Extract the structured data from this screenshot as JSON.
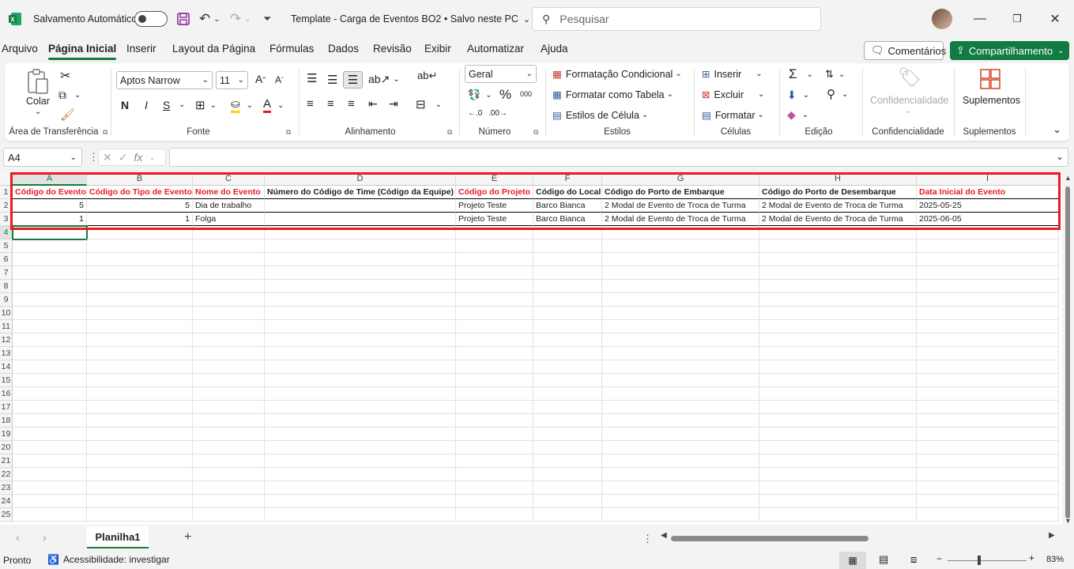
{
  "titlebar": {
    "autosave_label": "Salvamento Automático",
    "doc_title": "Template - Carga de Eventos BO2 • Salvo neste PC",
    "search_placeholder": "Pesquisar"
  },
  "menu": {
    "tabs": [
      "Arquivo",
      "Página Inicial",
      "Inserir",
      "Layout da Página",
      "Fórmulas",
      "Dados",
      "Revisão",
      "Exibir",
      "Automatizar",
      "Ajuda"
    ],
    "comments": "Comentários",
    "share": "Compartilhamento",
    "accent": "#107c41"
  },
  "ribbon": {
    "clipboard": {
      "paste": "Colar",
      "label": "Área de Transferência"
    },
    "font": {
      "name": "Aptos Narrow",
      "size": "11",
      "label": "Fonte",
      "bold": "N",
      "italic": "I",
      "underline": "S"
    },
    "alignment": {
      "label": "Alinhamento"
    },
    "number": {
      "format": "Geral",
      "label": "Número"
    },
    "styles": {
      "conditional": "Formatação Condicional",
      "table": "Formatar como Tabela",
      "cell": "Estilos de Célula",
      "label": "Estilos"
    },
    "cells": {
      "insert": "Inserir",
      "delete": "Excluir",
      "format": "Formatar",
      "label": "Células"
    },
    "editing": {
      "label": "Edição"
    },
    "sensitivity": {
      "btn": "Confidencialidade",
      "label": "Confidencialidade"
    },
    "addins": {
      "btn": "Suplementos",
      "label": "Suplementos"
    }
  },
  "formula": {
    "namebox": "A4",
    "fx": "fx",
    "content": ""
  },
  "sheet": {
    "columns": [
      "A",
      "B",
      "C",
      "D",
      "E",
      "F",
      "G",
      "H",
      "I"
    ],
    "rows": [
      "1",
      "2",
      "3",
      "4",
      "5",
      "6",
      "7",
      "8",
      "9",
      "10",
      "11",
      "12",
      "13",
      "14",
      "15",
      "16",
      "17",
      "18",
      "19",
      "20",
      "21",
      "22",
      "23",
      "24",
      "25"
    ],
    "header": [
      "Código do Evento",
      "Código do Tipo de Evento",
      "Nome do Evento",
      "Número do Código de Time (Código da Equipe)",
      "Código do Projeto",
      "Código do Local",
      "Código do Porto de Embarque",
      "Código do Porto de Desembarque",
      "Data Inicial do Evento"
    ],
    "data": [
      [
        "5",
        "5",
        "Dia de trabalho",
        "",
        "Projeto Teste",
        "Barco Bianca",
        "2 Modal de Evento de Troca de Turma",
        "2 Modal de Evento de Troca de Turma",
        "2025-05-25"
      ],
      [
        "1",
        "1",
        "Folga",
        "",
        "Projeto Teste",
        "Barco Bianca",
        "2 Modal de Evento de Troca de Turma",
        "2 Modal de Evento de Troca de Turma",
        "2025-06-05"
      ]
    ],
    "required_color": "#e81b23",
    "highlight_color": "#e81b23"
  },
  "sheet_tabs": {
    "active": "Planilha1",
    "add": "+"
  },
  "status": {
    "ready": "Pronto",
    "accessibility": "Acessibilidade: investigar",
    "zoom": "83%"
  }
}
